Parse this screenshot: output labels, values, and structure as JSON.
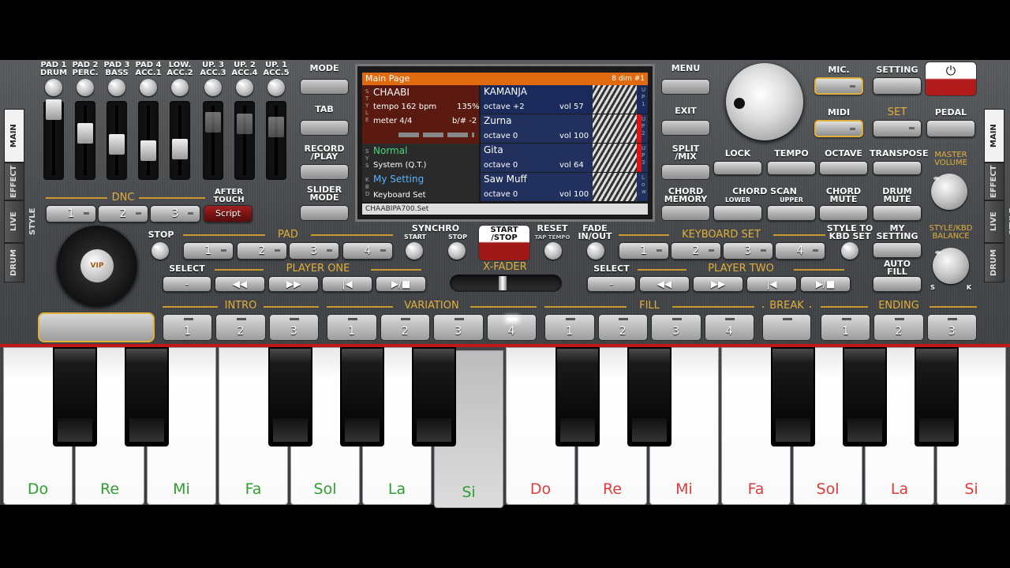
{
  "pads": [
    "PAD 1\nDRUM",
    "PAD 2\nPERC.",
    "PAD 3\nBASS",
    "PAD 4\nACC.1",
    "LOW.\nACC.2",
    "UP. 3\nACC.3",
    "UP. 2\nACC.4",
    "UP. 1\nACC.5"
  ],
  "dnc": {
    "title": "DNC",
    "buttons": [
      "1",
      "2",
      "3"
    ],
    "aftertouch": "AFTER\nTOUCH",
    "script": "Script"
  },
  "left_tabs": [
    "MAIN",
    "EFFECT",
    "LIVE STYLE",
    "DRUM"
  ],
  "right_tabs": [
    "MAIN",
    "EFFECT",
    "LIVE STYLE",
    "DRUM"
  ],
  "mid_left": {
    "mode": "MODE",
    "tab": "TAB",
    "record": "RECORD\n/PLAY",
    "slider": "SLIDER\nMODE"
  },
  "mid_right": {
    "menu": "MENU",
    "exit": "EXIT",
    "split": "SPLIT\n/MIX",
    "chord_memory": "CHORD\nMEMORY"
  },
  "screen": {
    "header_left": "Main Page",
    "header_right": "8 dim #1",
    "style_name": "CHAABI",
    "tempo": "tempo 162 bpm",
    "tempo_pct": "135%",
    "meter": "meter 4/4",
    "transpose": "b/# -2",
    "sys_name": "Normal",
    "sys_sub": "System (Q.T.)",
    "kbd_name": "My Setting",
    "kbd_sub": "Keyboard Set",
    "footer": "CHAABIPA700.Set",
    "style_tag": "STYLE",
    "sys_tag": "SYS",
    "kbd_tag": "KBD",
    "up1_tag": "UP1",
    "up2_tag": "UP2",
    "up3_tag": "UP3",
    "low_tag": "Low",
    "parts": [
      {
        "name": "KAMANJA",
        "octave": "octave +2",
        "vol": "vol 57"
      },
      {
        "name": "Zurna",
        "octave": "octave 0",
        "vol": "vol 100"
      },
      {
        "name": "Gita",
        "octave": "octave 0",
        "vol": "vol 64"
      },
      {
        "name": "Saw Muff",
        "octave": "octave 0",
        "vol": "vol 100"
      }
    ]
  },
  "top_right": {
    "mic": "MIC.",
    "setting": "SETTING",
    "midi": "MIDI",
    "set": "SET",
    "pedal": "PEDAL",
    "power": "⏻"
  },
  "row3": {
    "lock": "LOCK",
    "tempo": "TEMPO",
    "octave": "OCTAVE",
    "transpose": "TRANSPOSE",
    "master_volume": "MASTER\nVOLUME",
    "plus": "+",
    "minus": "-"
  },
  "row4": {
    "chord_scan": "CHORD SCAN",
    "lower": "LOWER",
    "upper": "UPPER",
    "chord_mute": "CHORD\nMUTE",
    "drum_mute": "DRUM\nMUTE"
  },
  "row5": {
    "stop": "STOP",
    "pad": "PAD",
    "pad_buttons": [
      "1",
      "2",
      "3",
      "4"
    ],
    "synchro": "SYNCHRO",
    "sync_start": "START",
    "sync_stop": "STOP",
    "start_stop": "START\n/STOP",
    "reset": "RESET",
    "tap_tempo": "TAP TEMPO",
    "fade": "FADE\nIN/OUT",
    "keyboard_set": "KEYBOARD SET",
    "kbd_buttons": [
      "1",
      "2",
      "3",
      "4"
    ],
    "style_to": "STYLE TO\nKBD SET",
    "my_setting": "MY\nSETTING",
    "balance": "STYLE/KBD\nBALANCE",
    "bal_s": "S",
    "bal_k": "K"
  },
  "row6": {
    "select": "SELECT",
    "player_one": "PLAYER ONE",
    "xfader": "X-FADER",
    "select2": "SELECT",
    "player_two": "PLAYER TWO",
    "auto_fill": "AUTO\nFILL"
  },
  "sections": {
    "intro": "INTRO",
    "variation": "VARIATION",
    "fill": "FILL",
    "break": "BREAK",
    "ending": "ENDING"
  },
  "intro_btns": [
    "1",
    "2",
    "3"
  ],
  "variation_btns": [
    "1",
    "2",
    "3",
    "4"
  ],
  "fill_btns": [
    "1",
    "2",
    "3",
    "4"
  ],
  "ending_btns": [
    "1",
    "2",
    "3"
  ],
  "transport": [
    "-",
    "◀◀",
    "▶▶",
    "|◀",
    "▶/■"
  ],
  "keys": [
    {
      "note": "Do",
      "color": "#2e9e2e"
    },
    {
      "note": "Re",
      "color": "#2e9e2e"
    },
    {
      "note": "Mi",
      "color": "#2e9e2e"
    },
    {
      "note": "Fa",
      "color": "#2e9e2e"
    },
    {
      "note": "Sol",
      "color": "#2e9e2e"
    },
    {
      "note": "La",
      "color": "#2e9e2e"
    },
    {
      "note": "Si",
      "color": "#2e9e2e"
    },
    {
      "note": "Do",
      "color": "#e03a3a"
    },
    {
      "note": "Re",
      "color": "#e03a3a"
    },
    {
      "note": "Mi",
      "color": "#e03a3a"
    },
    {
      "note": "Fa",
      "color": "#e03a3a"
    },
    {
      "note": "Sol",
      "color": "#e03a3a"
    },
    {
      "note": "La",
      "color": "#e03a3a"
    },
    {
      "note": "Si",
      "color": "#e03a3a"
    }
  ],
  "vip": "VIP"
}
